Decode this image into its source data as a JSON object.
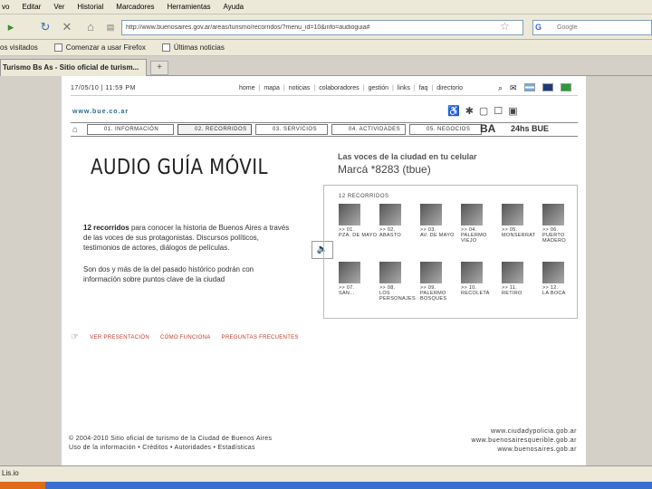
{
  "browser": {
    "menu": [
      "vo",
      "Editar",
      "Ver",
      "Historial",
      "Marcadores",
      "Herramientas",
      "Ayuda"
    ],
    "url": "http://www.buenosaires.gov.ar/areas/turismo/recorridos/?menu_id=10&info=audioguia#",
    "search_placeholder": "Google",
    "bookmarks": [
      "os visitados",
      "Comenzar a usar Firefox",
      "Últimas noticias"
    ],
    "tab_title": "Turismo Bs As - Sitio oficial de turism...",
    "new_tab": "+",
    "status": "Lis.io"
  },
  "site": {
    "date": "17/05/10 | 11:59 PM",
    "top_links": [
      "home",
      "mapa",
      "noticias",
      "colaboradores",
      "gestión",
      "links",
      "faq",
      "directorio"
    ],
    "logo_url": "www.bue.co.ar",
    "nav_tabs": [
      "01. INFORMACIÓN",
      "02. RECORRIDOS",
      "03. SERVICIOS",
      "04. ACTIVIDADES",
      "05. NEGOCIOS"
    ],
    "ba_logo": "BA",
    "bue24": "24hs BUE"
  },
  "content": {
    "title": "AUDIO GUÍA MÓVIL",
    "subtitle": "Las voces de la ciudad en tu celular",
    "sms": "Marcá *8283 (tbue)",
    "intro_bold": "12 recorridos",
    "intro_rest": "para conocer la historia de Buenos Aires a través de las voces de sus protagonistas. Discursos políticos, testimonios de actores, diálogos de películas.",
    "intro2": "Son dos y más de la del pasado histórico podrán con información sobre puntos clave de la ciudad",
    "panel_head": "12 RECORRIDOS",
    "tours": [
      {
        "num": ">> 01.",
        "name": "PZA. DE MAYO"
      },
      {
        "num": ">> 02.",
        "name": "ABASTO"
      },
      {
        "num": ">> 03.",
        "name": "AV. DE MAYO"
      },
      {
        "num": ">> 04.",
        "name": "PALERMO VIEJO"
      },
      {
        "num": ">> 05.",
        "name": "MONSERRAT"
      },
      {
        "num": ">> 06.",
        "name": "PUERTO MADERO"
      },
      {
        "num": ">> 07.",
        "name": "SAN..."
      },
      {
        "num": ">> 08.",
        "name": "LOS PERSONAJES"
      },
      {
        "num": ">> 09.",
        "name": "PALERMO BOSQUES"
      },
      {
        "num": ">> 10.",
        "name": "RECOLETA"
      },
      {
        "num": ">> 11.",
        "name": "RETIRO"
      },
      {
        "num": ">> 12.",
        "name": "LA BOCA"
      }
    ],
    "links": [
      "VER PRESENTACIÓN",
      "CÓMO FUNCIONA",
      "PREGUNTAS FRECUENTES"
    ]
  },
  "footer": {
    "line1": "© 2004-2010 Sitio oficial de turismo de la Ciudad de Buenos Aires",
    "line2": "Uso de la información • Créditos • Autoridades • Estadísticas",
    "sites": [
      "www.ciudadypolicia.gob.ar",
      "www.buenosairesquerible.gob.ar",
      "www.buenosaires.gob.ar"
    ]
  }
}
